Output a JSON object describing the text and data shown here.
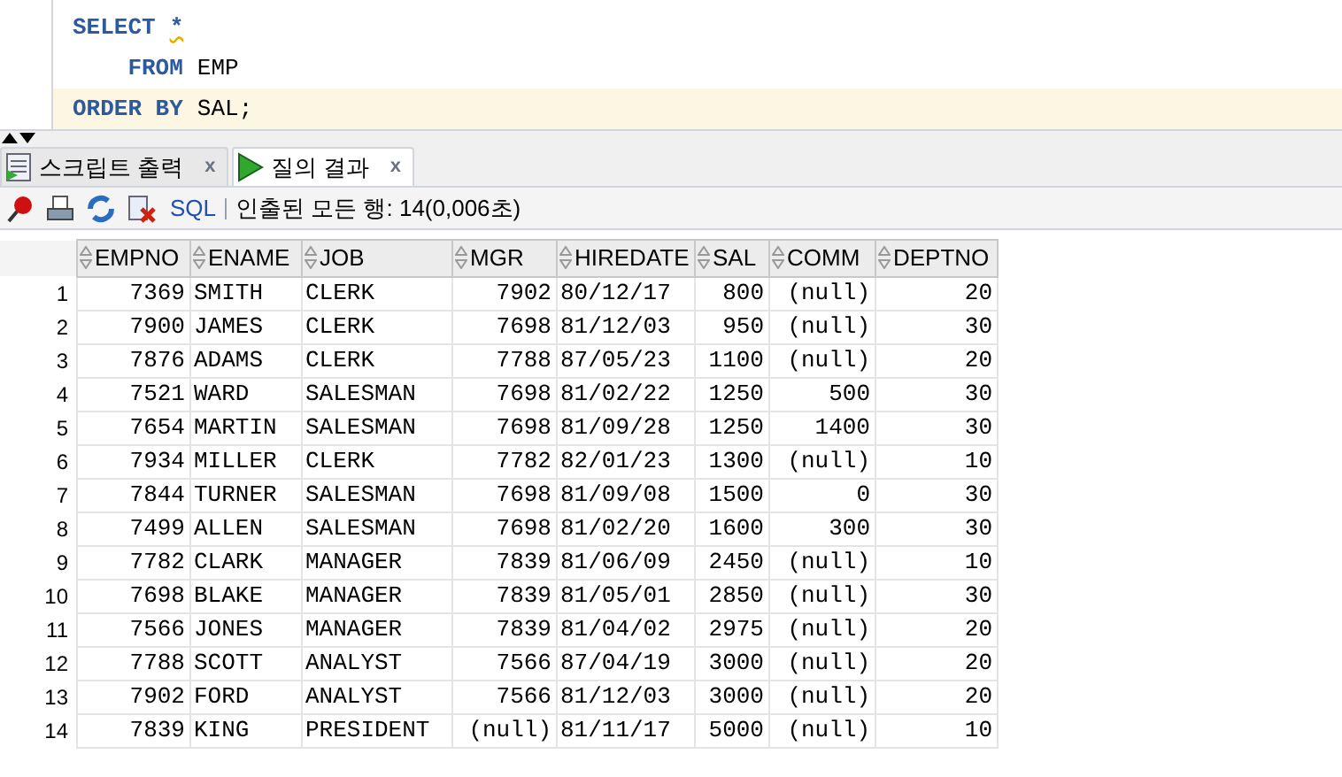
{
  "editor": {
    "lines": [
      {
        "current": false,
        "tokens": [
          {
            "text": "SELECT",
            "kind": "keyword"
          },
          {
            "text": "*",
            "kind": "warning"
          }
        ]
      },
      {
        "current": false,
        "tokens": [
          {
            "text": "    FROM",
            "kind": "keyword"
          },
          {
            "text": "EMP",
            "kind": "plain"
          }
        ]
      },
      {
        "current": true,
        "tokens": [
          {
            "text": "ORDER BY",
            "kind": "keyword"
          },
          {
            "text": "SAL;",
            "kind": "plain"
          }
        ]
      }
    ]
  },
  "tabs": [
    {
      "label": "스크립트 출력",
      "kind": "script",
      "selected": false,
      "close": "x"
    },
    {
      "label": "질의 결과",
      "kind": "play",
      "selected": true,
      "close": "x"
    }
  ],
  "toolbar": {
    "sql_link": "SQL",
    "status": "인출된 모든 행: 14(0,006초)"
  },
  "table": {
    "columns": [
      {
        "label": "EMPNO",
        "kind": "number"
      },
      {
        "label": "ENAME",
        "kind": "text"
      },
      {
        "label": "JOB",
        "kind": "text"
      },
      {
        "label": "MGR",
        "kind": "number"
      },
      {
        "label": "HIREDATE",
        "kind": "text"
      },
      {
        "label": "SAL",
        "kind": "number"
      },
      {
        "label": "COMM",
        "kind": "number"
      },
      {
        "label": "DEPTNO",
        "kind": "number"
      }
    ],
    "rows": [
      {
        "number": "1",
        "cells": [
          "7369",
          "SMITH",
          "CLERK",
          "7902",
          "80/12/17",
          "800",
          "(null)",
          "20"
        ]
      },
      {
        "number": "2",
        "cells": [
          "7900",
          "JAMES",
          "CLERK",
          "7698",
          "81/12/03",
          "950",
          "(null)",
          "30"
        ]
      },
      {
        "number": "3",
        "cells": [
          "7876",
          "ADAMS",
          "CLERK",
          "7788",
          "87/05/23",
          "1100",
          "(null)",
          "20"
        ]
      },
      {
        "number": "4",
        "cells": [
          "7521",
          "WARD",
          "SALESMAN",
          "7698",
          "81/02/22",
          "1250",
          "500",
          "30"
        ]
      },
      {
        "number": "5",
        "cells": [
          "7654",
          "MARTIN",
          "SALESMAN",
          "7698",
          "81/09/28",
          "1250",
          "1400",
          "30"
        ]
      },
      {
        "number": "6",
        "cells": [
          "7934",
          "MILLER",
          "CLERK",
          "7782",
          "82/01/23",
          "1300",
          "(null)",
          "10"
        ]
      },
      {
        "number": "7",
        "cells": [
          "7844",
          "TURNER",
          "SALESMAN",
          "7698",
          "81/09/08",
          "1500",
          "0",
          "30"
        ]
      },
      {
        "number": "8",
        "cells": [
          "7499",
          "ALLEN",
          "SALESMAN",
          "7698",
          "81/02/20",
          "1600",
          "300",
          "30"
        ]
      },
      {
        "number": "9",
        "cells": [
          "7782",
          "CLARK",
          "MANAGER",
          "7839",
          "81/06/09",
          "2450",
          "(null)",
          "10"
        ]
      },
      {
        "number": "10",
        "cells": [
          "7698",
          "BLAKE",
          "MANAGER",
          "7839",
          "81/05/01",
          "2850",
          "(null)",
          "30"
        ]
      },
      {
        "number": "11",
        "cells": [
          "7566",
          "JONES",
          "MANAGER",
          "7839",
          "81/04/02",
          "2975",
          "(null)",
          "20"
        ]
      },
      {
        "number": "12",
        "cells": [
          "7788",
          "SCOTT",
          "ANALYST",
          "7566",
          "87/04/19",
          "3000",
          "(null)",
          "20"
        ]
      },
      {
        "number": "13",
        "cells": [
          "7902",
          "FORD",
          "ANALYST",
          "7566",
          "81/12/03",
          "3000",
          "(null)",
          "20"
        ]
      },
      {
        "number": "14",
        "cells": [
          "7839",
          "KING",
          "PRESIDENT",
          "(null)",
          "81/11/17",
          "5000",
          "(null)",
          "10"
        ]
      }
    ]
  }
}
